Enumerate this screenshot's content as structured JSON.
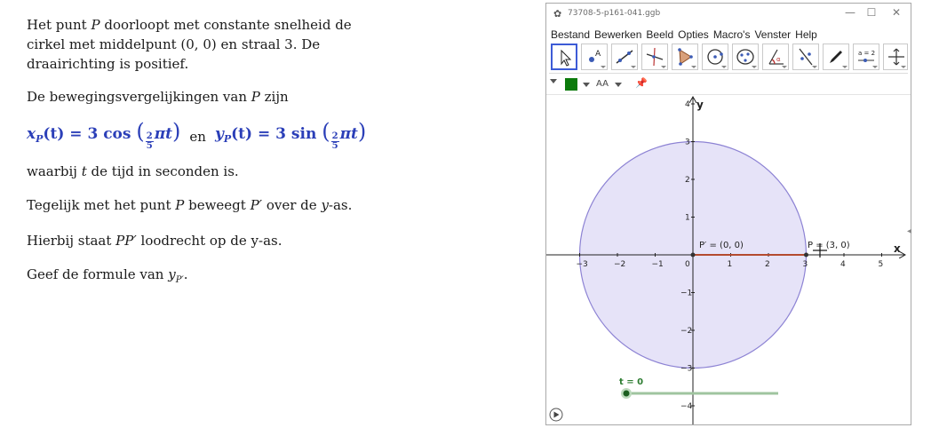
{
  "exercise": {
    "p1_lines": [
      "Het punt",
      "P",
      "doorloopt met constante snelheid de",
      "cirkel met middelpunt (0, 0) en straal 3. De",
      "draairichting is positief."
    ],
    "p2": [
      "De bewegingsvergelijkingen van ",
      "P",
      " zijn"
    ],
    "formula": {
      "x_lhs": "x",
      "x_sub": "P",
      "x_arg": "(t)",
      "eq": "= 3 cos",
      "frac_num": "2",
      "frac_den": "5",
      "pi_t": "πt",
      "en": "en",
      "y_lhs": "y",
      "y_sub": "P",
      "y_arg": "(t)",
      "eq2": "= 3 sin"
    },
    "p4": [
      "waarbij ",
      "t",
      " de tijd in seconden is."
    ],
    "p5": [
      "Tegelijk met het punt ",
      "P",
      " beweegt ",
      "P′",
      " over de ",
      "y",
      "-as."
    ],
    "p6": [
      "Hierbij staat ",
      "PP′",
      " loodrecht op de y-as."
    ],
    "p7": [
      "Geef de formule van ",
      "y",
      "P′",
      "."
    ]
  },
  "window": {
    "title": "73708-5-p161-041.ggb",
    "controls": [
      "—",
      "☐",
      "✕"
    ],
    "menu": [
      "Bestand",
      "Bewerken",
      "Beeld",
      "Opties",
      "Macro's",
      "Venster",
      "Help"
    ],
    "tools": [
      "move-tool",
      "point-tool",
      "line-tool",
      "perpendicular-tool",
      "polygon-tool",
      "circle-tool",
      "conic-tool",
      "angle-tool",
      "reflect-tool",
      "pen-tool",
      "slider-tool",
      "move-view-tool"
    ],
    "slider_tool_label": "a = 2",
    "style_font_label": "AA",
    "colors": {
      "accent": "#3d5bd6",
      "circle_fill": "#e6e3f8",
      "circle_stroke": "#8d83d4",
      "segment": "#b44b2f",
      "slider": "#2e7d32",
      "point": "#333333",
      "style_color": "#0b7a0b"
    }
  },
  "graph": {
    "axis_x_label": "x",
    "axis_y_label": "y",
    "x_ticks": [
      "−3",
      "−2",
      "−1",
      "0",
      "1",
      "2",
      "3",
      "4",
      "5"
    ],
    "y_ticks_pos": [
      "4",
      "3",
      "2",
      "1"
    ],
    "y_ticks_neg": [
      "−1",
      "−2",
      "−3",
      "−4"
    ],
    "label_pprime": "P′ = (0, 0)",
    "label_p": "P = (3, 0)",
    "slider_label": "t = 0",
    "circle_radius": 3,
    "p_point": [
      3,
      0
    ],
    "pprime_point": [
      0,
      0
    ],
    "slider_value": 0
  }
}
